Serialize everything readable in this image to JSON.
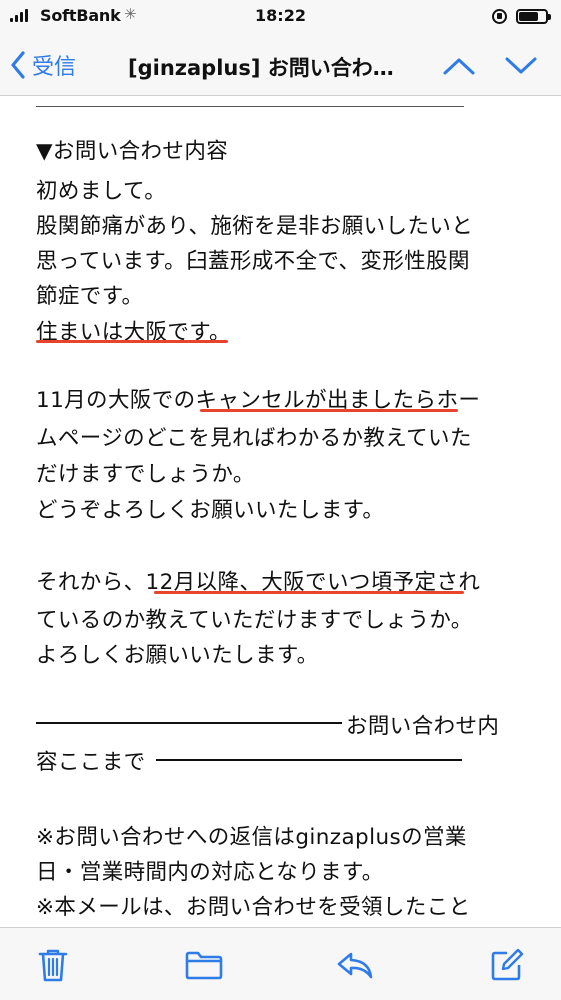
{
  "status_bar": {
    "carrier": "SoftBank",
    "time": "18:22",
    "battery_level": 0.8
  },
  "nav": {
    "back_label": "受信",
    "title": "[ginzaplus] お問い合わ…",
    "icons": [
      "chevron-left-icon",
      "chevron-up-icon",
      "chevron-down-icon"
    ],
    "accent_color": "#2f7be8"
  },
  "message": {
    "lines": [
      "▼お問い合わせ内容",
      "初めまして。",
      "股関節痛があり、施術を是非お願いしたいと",
      "思っています。臼蓋形成不全で、変形性股関",
      "節症です。",
      "住まいは大阪です。",
      "11月の大阪でのキャンセルが出ましたらホー",
      "ムページのどこを見ればわかるか教えていた",
      "だけますでしょうか。",
      "どうぞよろしくお願いいたします。",
      "それから、12月以降、大阪でいつ頃予定され",
      "ているのか教えていただけますでしょうか。",
      "よろしくお願いいたします。",
      "お問い合わせ内",
      "容ここまで",
      "※お問い合わせへの返信はginzaplusの営業",
      "日・営業時間内の対応となります。",
      "※本メールは、お問い合わせを受領したこと"
    ],
    "highlight_color": "#e8442d"
  },
  "toolbar": {
    "icons": [
      "trash-icon",
      "folder-icon",
      "reply-icon",
      "compose-icon"
    ]
  }
}
